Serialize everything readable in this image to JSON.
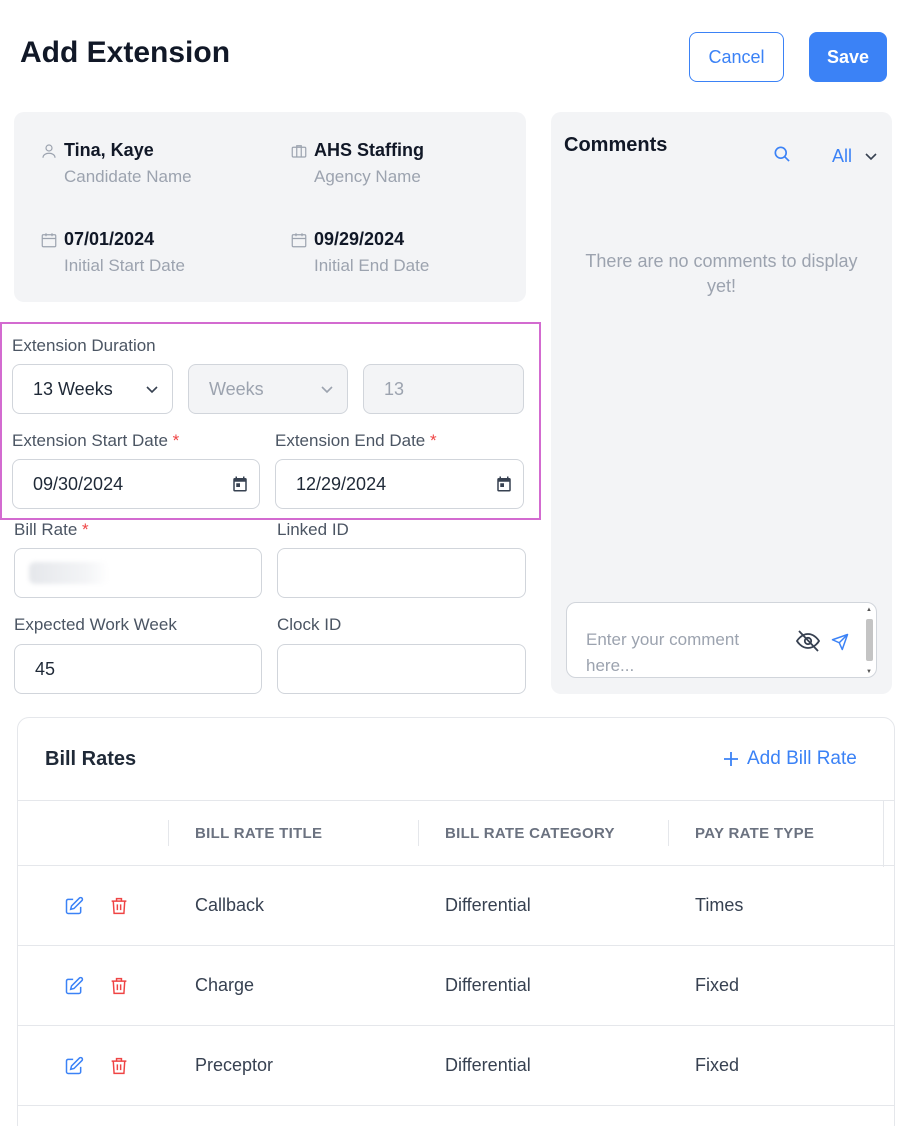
{
  "header": {
    "title": "Add Extension",
    "cancel_label": "Cancel",
    "save_label": "Save"
  },
  "info": {
    "candidate": {
      "value": "Tina, Kaye",
      "label": "Candidate Name",
      "icon": "person-icon"
    },
    "agency": {
      "value": "AHS Staffing",
      "label": "Agency Name",
      "icon": "briefcase-icon"
    },
    "start": {
      "value": "07/01/2024",
      "label": "Initial Start Date",
      "icon": "calendar-icon"
    },
    "end": {
      "value": "09/29/2024",
      "label": "Initial End Date",
      "icon": "calendar-icon"
    }
  },
  "form": {
    "duration_label": "Extension Duration",
    "duration_select": "13 Weeks",
    "unit_select": "Weeks",
    "unit_count": "13",
    "start_label": "Extension Start Date",
    "start_value": "09/30/2024",
    "end_label": "Extension End Date",
    "end_value": "12/29/2024",
    "bill_rate_label": "Bill Rate",
    "linked_id_label": "Linked ID",
    "linked_id_value": "",
    "work_week_label": "Expected Work Week",
    "work_week_value": "45",
    "clock_id_label": "Clock ID",
    "clock_id_value": "",
    "required_mark": "*"
  },
  "comments": {
    "title": "Comments",
    "filter": "All",
    "empty_text": "There are no comments to display yet!",
    "input_placeholder": "Enter your comment here..."
  },
  "bill_rates": {
    "title": "Bill Rates",
    "add_label": "Add Bill Rate",
    "columns": [
      "BILL RATE TITLE",
      "BILL RATE CATEGORY",
      "PAY RATE TYPE"
    ],
    "rows": [
      {
        "title": "Callback",
        "category": "Differential",
        "type": "Times"
      },
      {
        "title": "Charge",
        "category": "Differential",
        "type": "Fixed"
      },
      {
        "title": "Preceptor",
        "category": "Differential",
        "type": "Fixed"
      }
    ]
  },
  "colors": {
    "accent": "#3b82f6",
    "danger": "#ef4444",
    "highlight": "#d36bd0",
    "panel": "#f3f4f6"
  }
}
